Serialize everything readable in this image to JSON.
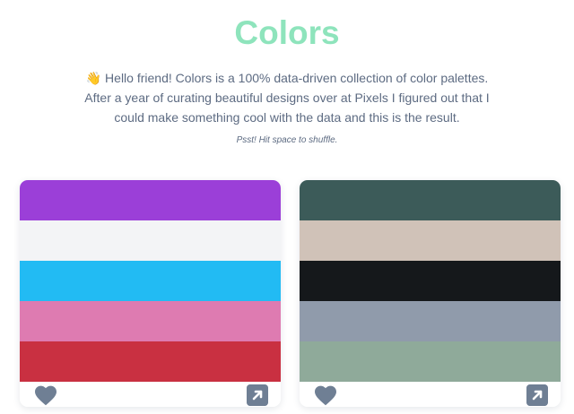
{
  "header": {
    "title": "Colors",
    "wave_emoji": "👋",
    "intro_before_link": " Hello friend! Colors is a 100% data-driven collection of color palettes. After a year of curating beautiful designs over at ",
    "intro_link": "Pixels",
    "intro_after_link": " I figured out that I could make something cool with the data and this is the result.",
    "hint": "Psst! Hit space to shuffle."
  },
  "palettes": [
    {
      "colors": [
        "#9b3fd8",
        "#f3f4f6",
        "#22bbf3",
        "#de7bb1",
        "#c93041"
      ]
    },
    {
      "colors": [
        "#3c5b59",
        "#d0c2b8",
        "#15181b",
        "#909bab",
        "#8faa9a"
      ]
    }
  ],
  "icons": {
    "like": "heart-icon",
    "open": "external-link-icon"
  },
  "colors": {
    "accent": "#8ee4bc",
    "text": "#5d6b82",
    "icon": "#6f7f94"
  }
}
